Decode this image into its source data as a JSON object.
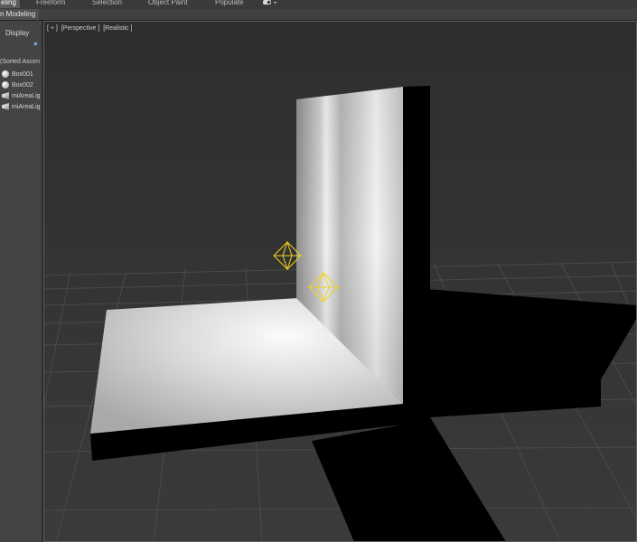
{
  "ribbon": {
    "tabs": [
      {
        "label": "eling",
        "active": true
      },
      {
        "label": "Freeform",
        "active": false
      },
      {
        "label": "Selection",
        "active": false
      },
      {
        "label": "Object Paint",
        "active": false
      },
      {
        "label": "Populate",
        "active": false
      }
    ],
    "section_label": "n Modeling",
    "extra_icon": "toggle-dropdown-icon"
  },
  "explorer": {
    "display_label": "Display",
    "sort_label": "(Sorted Ascen",
    "objects": [
      {
        "name": "Box001",
        "icon": "sphere"
      },
      {
        "name": "Box002",
        "icon": "sphere"
      },
      {
        "name": "miAreaLig",
        "icon": "light"
      },
      {
        "name": "miAreaLig",
        "icon": "light"
      }
    ]
  },
  "viewport": {
    "labels": [
      "[ + ]",
      "[Perspective ]",
      "[Realistic ]"
    ],
    "grid_color": "#4a4a4a",
    "light_gizmo_color": "#f2d21e"
  }
}
